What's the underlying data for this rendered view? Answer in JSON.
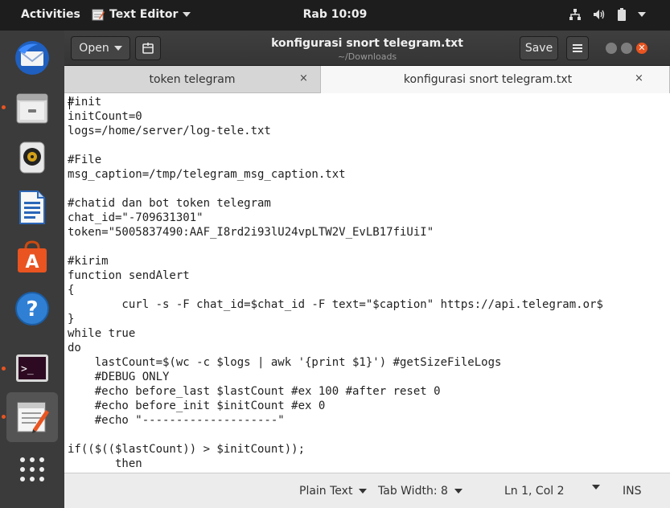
{
  "topbar": {
    "activities": "Activities",
    "app_menu": "Text Editor",
    "clock": "Rab 10:09"
  },
  "dock": {
    "items": [
      "thunderbird-icon",
      "files-icon",
      "rhythmbox-icon",
      "writer-icon",
      "software-icon",
      "help-icon",
      "terminal-icon",
      "text-editor-icon",
      "app-grid-icon"
    ]
  },
  "headerbar": {
    "open_label": "Open",
    "title": "konfigurasi snort telegram.txt",
    "subtitle": "~/Downloads",
    "save_label": "Save"
  },
  "tabs": [
    {
      "label": "token telegram",
      "close": "×"
    },
    {
      "label": "konfigurasi snort telegram.txt",
      "close": "×"
    }
  ],
  "editor": {
    "lines": [
      "#init",
      "initCount=0",
      "logs=/home/server/log-tele.txt",
      "",
      "#File",
      "msg_caption=/tmp/telegram_msg_caption.txt",
      "",
      "#chatid dan bot token telegram",
      "chat_id=\"-709631301\"",
      "token=\"5005837490:AAF_I8rd2i93lU24vpLTW2V_EvLB17fiUiI\"",
      "",
      "#kirim",
      "function sendAlert",
      "{",
      "        curl -s -F chat_id=$chat_id -F text=\"$caption\" https://api.telegram.or$",
      "}",
      "while true",
      "do",
      "    lastCount=$(wc -c $logs | awk '{print $1}') #getSizeFileLogs",
      "    #DEBUG ONLY",
      "    #echo before_last $lastCount #ex 100 #after reset 0",
      "    #echo before_init $initCount #ex 0",
      "    #echo \"--------------------\"",
      "",
      "if(($(($lastCount)) > $initCount));",
      "       then"
    ]
  },
  "statusbar": {
    "language": "Plain Text",
    "tab_width": "Tab Width: 8",
    "position": "Ln 1, Col 2",
    "mode": "INS"
  }
}
